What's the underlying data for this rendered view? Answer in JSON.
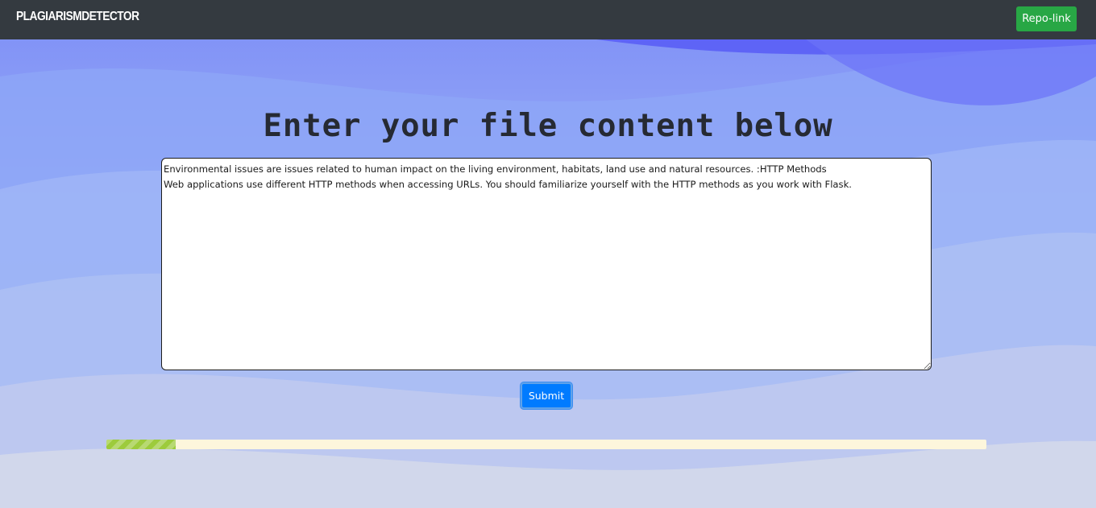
{
  "navbar": {
    "brand": "PLAGIARISMDETECTOR",
    "repo_button": "Repo-link"
  },
  "main": {
    "title": "Enter your file content below",
    "content_text": "Environmental issues are issues related to human impact on the living environment, habitats, land use and natural resources. :HTTP Methods\nWeb applications use different HTTP methods when accessing URLs. You should familiarize yourself with the HTTP methods as you work with Flask.",
    "submit_label": "Submit"
  },
  "progress": {
    "fraction": 0.079
  },
  "colors": {
    "navbar_bg": "#343a40",
    "repo_button_bg": "#28a745",
    "submit_button_bg": "#007bff",
    "progress_fill": "#9dcb3c",
    "progress_track": "#fdf6dc"
  }
}
